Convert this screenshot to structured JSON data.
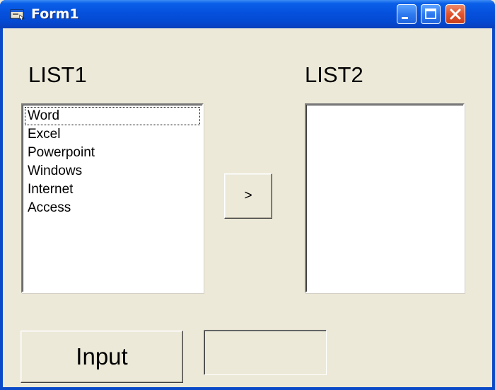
{
  "window": {
    "title": "Form1",
    "colors": {
      "titlebar": "#0551dd",
      "face": "#ece9d8",
      "close": "#e0532e"
    },
    "controls": {
      "minimize_icon": "minimize-icon",
      "maximize_icon": "maximize-icon",
      "close_icon": "close-icon"
    }
  },
  "form": {
    "list1_label": "LIST1",
    "list2_label": "LIST2",
    "list1_items": [
      "Word",
      "Excel",
      "Powerpoint",
      "Windows",
      "Internet",
      "Access"
    ],
    "list1_focused_index": 0,
    "list2_items": [],
    "move_button_label": ">",
    "input_button_label": "Input",
    "textbox_value": ""
  }
}
